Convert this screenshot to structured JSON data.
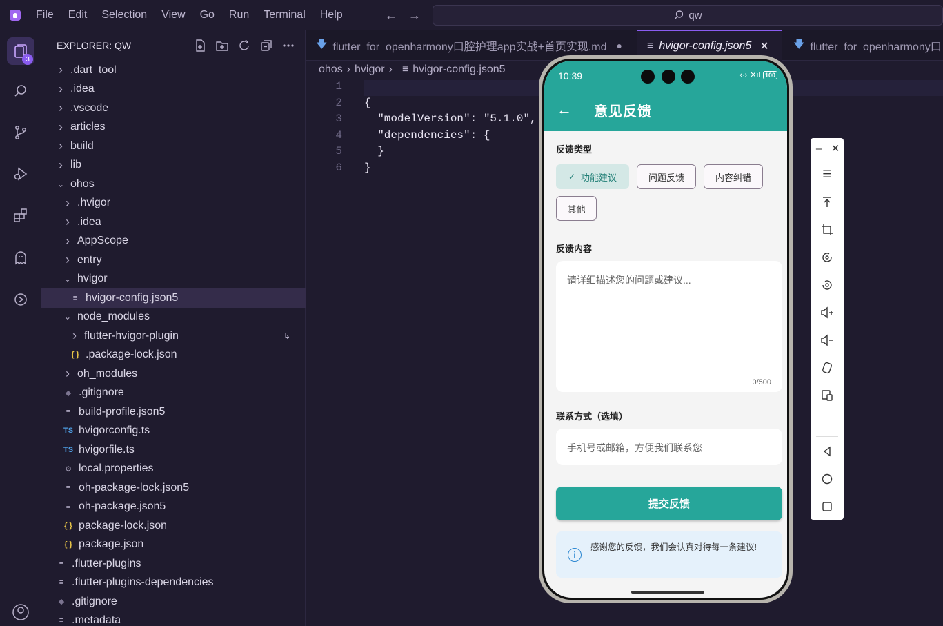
{
  "menu": [
    "File",
    "Edit",
    "Selection",
    "View",
    "Go",
    "Run",
    "Terminal",
    "Help"
  ],
  "search": {
    "text": "qw"
  },
  "activity": {
    "explorer_badge": "3"
  },
  "sidebar": {
    "title": "EXPLORER: QW",
    "items": [
      {
        "label": ".dart_tool",
        "type": "folder",
        "depth": 0,
        "open": false
      },
      {
        "label": ".idea",
        "type": "folder",
        "depth": 0,
        "open": false
      },
      {
        "label": ".vscode",
        "type": "folder",
        "depth": 0,
        "open": false
      },
      {
        "label": "articles",
        "type": "folder",
        "depth": 0,
        "open": false
      },
      {
        "label": "build",
        "type": "folder",
        "depth": 0,
        "open": false
      },
      {
        "label": "lib",
        "type": "folder",
        "depth": 0,
        "open": false
      },
      {
        "label": "ohos",
        "type": "folder",
        "depth": 0,
        "open": true
      },
      {
        "label": ".hvigor",
        "type": "folder",
        "depth": 1,
        "open": false
      },
      {
        "label": ".idea",
        "type": "folder",
        "depth": 1,
        "open": false
      },
      {
        "label": "AppScope",
        "type": "folder",
        "depth": 1,
        "open": false
      },
      {
        "label": "entry",
        "type": "folder",
        "depth": 1,
        "open": false
      },
      {
        "label": "hvigor",
        "type": "folder",
        "depth": 1,
        "open": true
      },
      {
        "label": "hvigor-config.json5",
        "type": "lines",
        "depth": 2,
        "selected": true
      },
      {
        "label": "node_modules",
        "type": "folder",
        "depth": 1,
        "open": true
      },
      {
        "label": "flutter-hvigor-plugin",
        "type": "folder",
        "depth": 2,
        "open": false,
        "symlink": true
      },
      {
        "label": ".package-lock.json",
        "type": "json",
        "depth": 2
      },
      {
        "label": "oh_modules",
        "type": "folder",
        "depth": 1,
        "open": false
      },
      {
        "label": ".gitignore",
        "type": "git",
        "depth": 1
      },
      {
        "label": "build-profile.json5",
        "type": "lines",
        "depth": 1
      },
      {
        "label": "hvigorconfig.ts",
        "type": "ts",
        "depth": 1
      },
      {
        "label": "hvigorfile.ts",
        "type": "ts",
        "depth": 1
      },
      {
        "label": "local.properties",
        "type": "gear",
        "depth": 1
      },
      {
        "label": "oh-package-lock.json5",
        "type": "lines",
        "depth": 1
      },
      {
        "label": "oh-package.json5",
        "type": "lines",
        "depth": 1
      },
      {
        "label": "package-lock.json",
        "type": "json",
        "depth": 1
      },
      {
        "label": "package.json",
        "type": "json",
        "depth": 1
      },
      {
        "label": ".flutter-plugins",
        "type": "lines",
        "depth": 0
      },
      {
        "label": ".flutter-plugins-dependencies",
        "type": "lines",
        "depth": 0
      },
      {
        "label": ".gitignore",
        "type": "git",
        "depth": 0
      },
      {
        "label": ".metadata",
        "type": "lines",
        "depth": 0
      }
    ]
  },
  "tabs": [
    {
      "label": "flutter_for_openharmony口腔护理app实战+首页实现.md",
      "active": false,
      "dirty": true
    },
    {
      "label": "hvigor-config.json5",
      "active": true
    },
    {
      "label": "flutter_for_openharmony口",
      "active": false
    }
  ],
  "breadcrumb": [
    "ohos",
    "hvigor",
    "hvigor-config.json5"
  ],
  "code": {
    "lines": [
      {
        "n": "1",
        "text": ""
      },
      {
        "n": "2",
        "text": "{"
      },
      {
        "n": "3",
        "text": "  \"modelVersion\": \"5.1.0\","
      },
      {
        "n": "4",
        "text": "  \"dependencies\": {"
      },
      {
        "n": "5",
        "text": "  }"
      },
      {
        "n": "6",
        "text": "}"
      }
    ]
  },
  "phone": {
    "time": "10:39",
    "battery": "100",
    "title": "意见反馈",
    "type_label": "反馈类型",
    "chips": [
      {
        "label": "功能建议",
        "selected": true
      },
      {
        "label": "问题反馈",
        "selected": false
      },
      {
        "label": "内容纠错",
        "selected": false
      },
      {
        "label": "其他",
        "selected": false
      }
    ],
    "content_label": "反馈内容",
    "content_placeholder": "请详细描述您的问题或建议...",
    "counter": "0/500",
    "contact_label": "联系方式（选填）",
    "contact_placeholder": "手机号或邮箱，方便我们联系您",
    "submit": "提交反馈",
    "info": "感谢您的反馈，我们会认真对待每一条建议!",
    "accent": "#26a69a"
  }
}
